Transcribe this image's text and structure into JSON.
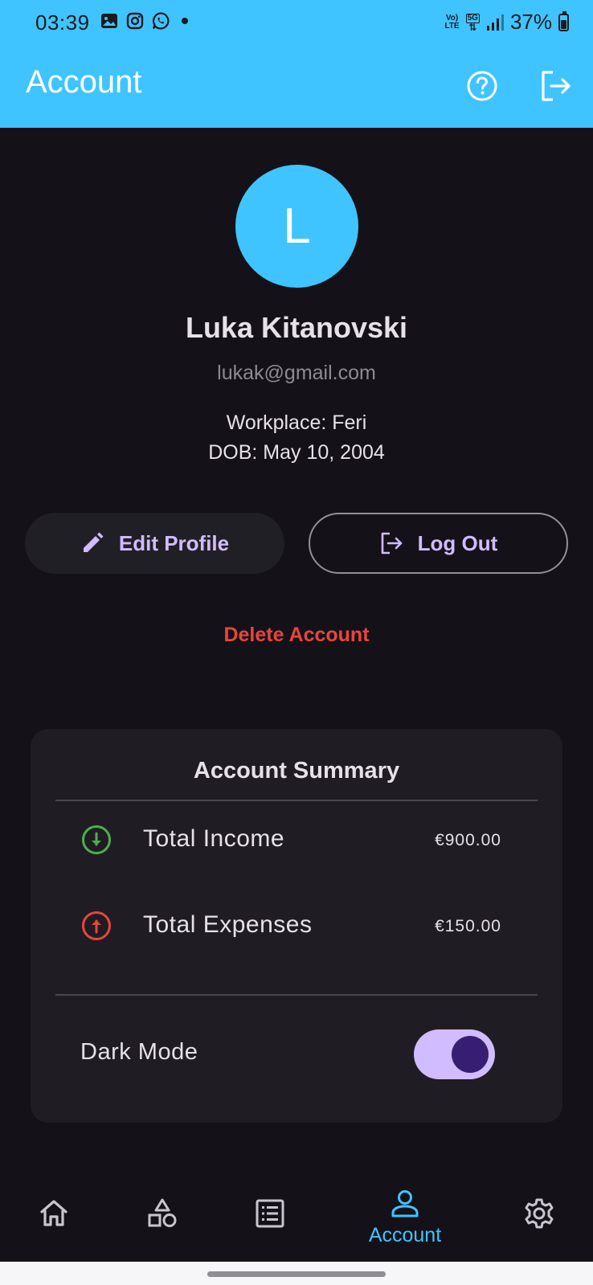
{
  "status_bar": {
    "time": "03:39",
    "battery": "37%",
    "network_label_top": "Vo)",
    "network_label_bottom": "LTE",
    "network_5g": "5G"
  },
  "app_bar": {
    "title": "Account",
    "help_icon": "help-circle-icon",
    "logout_icon": "logout-icon"
  },
  "profile": {
    "initial": "L",
    "name": "Luka Kitanovski",
    "email": "lukak@gmail.com",
    "workplace": "Workplace: Feri",
    "dob": "DOB: May 10, 2004"
  },
  "actions": {
    "edit_profile": "Edit Profile",
    "log_out": "Log Out",
    "delete_account": "Delete Account"
  },
  "summary": {
    "title": "Account Summary",
    "income_label": "Total Income",
    "income_value": "€900.00",
    "expenses_label": "Total Expenses",
    "expenses_value": "€150.00",
    "dark_mode_label": "Dark Mode",
    "dark_mode_on": true
  },
  "nav": {
    "items": [
      {
        "icon": "home-icon"
      },
      {
        "icon": "categories-icon"
      },
      {
        "icon": "list-icon"
      },
      {
        "icon": "account-icon",
        "label": "Account",
        "active": true
      },
      {
        "icon": "settings-icon"
      }
    ]
  },
  "colors": {
    "accent": "#40C4FF",
    "background": "#141218",
    "card": "#1f1d23",
    "primary_text": "#d0bcff",
    "danger": "#e8453c",
    "income_green": "#4caf50",
    "expense_red": "#e8453c"
  }
}
